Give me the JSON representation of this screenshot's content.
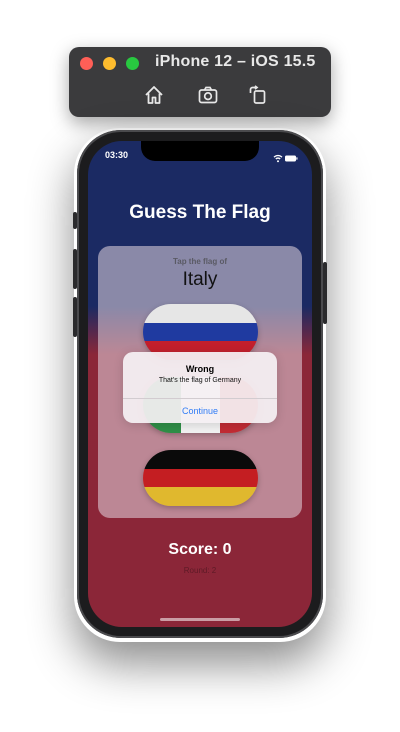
{
  "simulator": {
    "title": "iPhone 12 – iOS 15.5",
    "toolbar_icons": [
      "home-icon",
      "screenshot-icon",
      "rotate-icon"
    ]
  },
  "status_bar": {
    "time": "03:30"
  },
  "app": {
    "title": "Guess The Flag",
    "prompt": "Tap the flag of",
    "country": "Italy",
    "flags": [
      {
        "country": "Russia",
        "colors": [
          "#e6e6e6",
          "#1f3aa0",
          "#c21f2c"
        ]
      },
      {
        "country": "Italy",
        "colors": [
          "#2f8f47",
          "#f2f2f2",
          "#c22b34"
        ]
      },
      {
        "country": "Germany",
        "colors": [
          "#0a0a0a",
          "#c41e22",
          "#e0b82e"
        ]
      }
    ],
    "score": "Score: 0",
    "round": "Round: 2"
  },
  "alert": {
    "title": "Wrong",
    "message": "That's the flag of Germany",
    "button": "Continue"
  },
  "colors": {
    "background_top": "#1b2a63",
    "background_bottom": "#8b2638",
    "alert_button": "#2f7cf6"
  }
}
